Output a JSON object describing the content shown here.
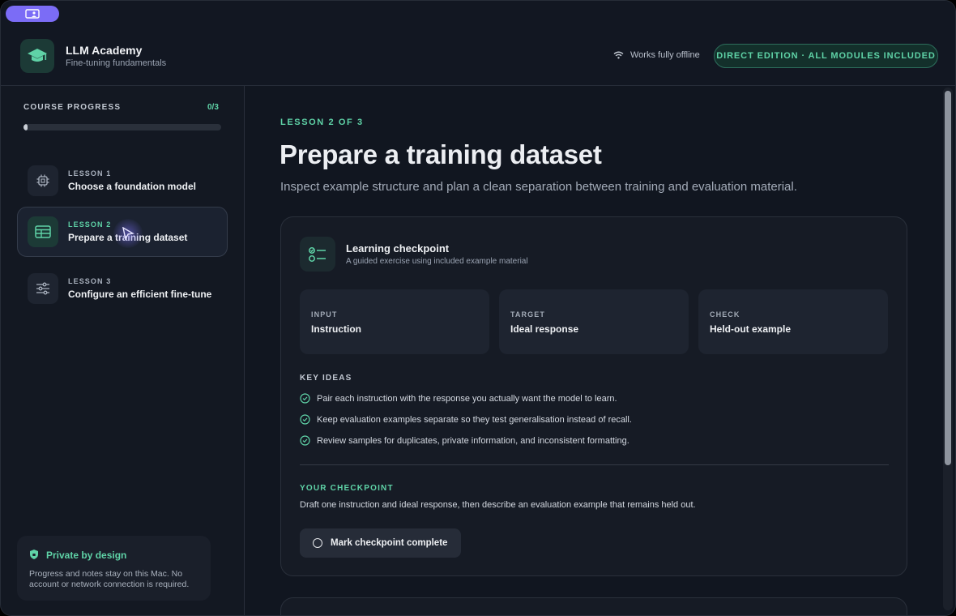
{
  "app": {
    "brand_title": "LLM Academy",
    "brand_subtitle": "Fine-tuning fundamentals",
    "offline_label": "Works fully offline",
    "edition_badge": "DIRECT EDITION · ALL MODULES INCLUDED"
  },
  "sidebar": {
    "progress_label": "COURSE PROGRESS",
    "progress_count": "0/3",
    "progress_fraction": 0.02,
    "lessons": [
      {
        "number": "LESSON 1",
        "title": "Choose a foundation model",
        "icon": "chip-icon"
      },
      {
        "number": "LESSON 2",
        "title": "Prepare a training dataset",
        "icon": "table-icon"
      },
      {
        "number": "LESSON 3",
        "title": "Configure an efficient fine-tune",
        "icon": "sliders-icon"
      }
    ],
    "privacy": {
      "title": "Private by design",
      "text": "Progress and notes stay on this Mac. No account or network connection is required."
    }
  },
  "main": {
    "eyebrow": "LESSON 2 OF 3",
    "title": "Prepare a training dataset",
    "subtitle": "Inspect example structure and plan a clean separation between training and evaluation material.",
    "checkpoint_card": {
      "title": "Learning checkpoint",
      "subtitle": "A guided exercise using included example material",
      "fields": [
        {
          "label": "INPUT",
          "value": "Instruction"
        },
        {
          "label": "TARGET",
          "value": "Ideal response"
        },
        {
          "label": "CHECK",
          "value": "Held-out example"
        }
      ],
      "key_ideas_label": "KEY IDEAS",
      "key_ideas": [
        "Pair each instruction with the response you actually want the model to learn.",
        "Keep evaluation examples separate so they test generalisation instead of recall.",
        "Review samples for duplicates, private information, and inconsistent formatting."
      ],
      "your_checkpoint_label": "YOUR CHECKPOINT",
      "your_checkpoint_text": "Draft one instruction and ideal response, then describe an evaluation example that remains held out.",
      "complete_button": "Mark checkpoint complete"
    }
  },
  "colors": {
    "accent": "#5fd3a7",
    "background": "#111620",
    "cursor_pill": "#7b6cf6"
  }
}
